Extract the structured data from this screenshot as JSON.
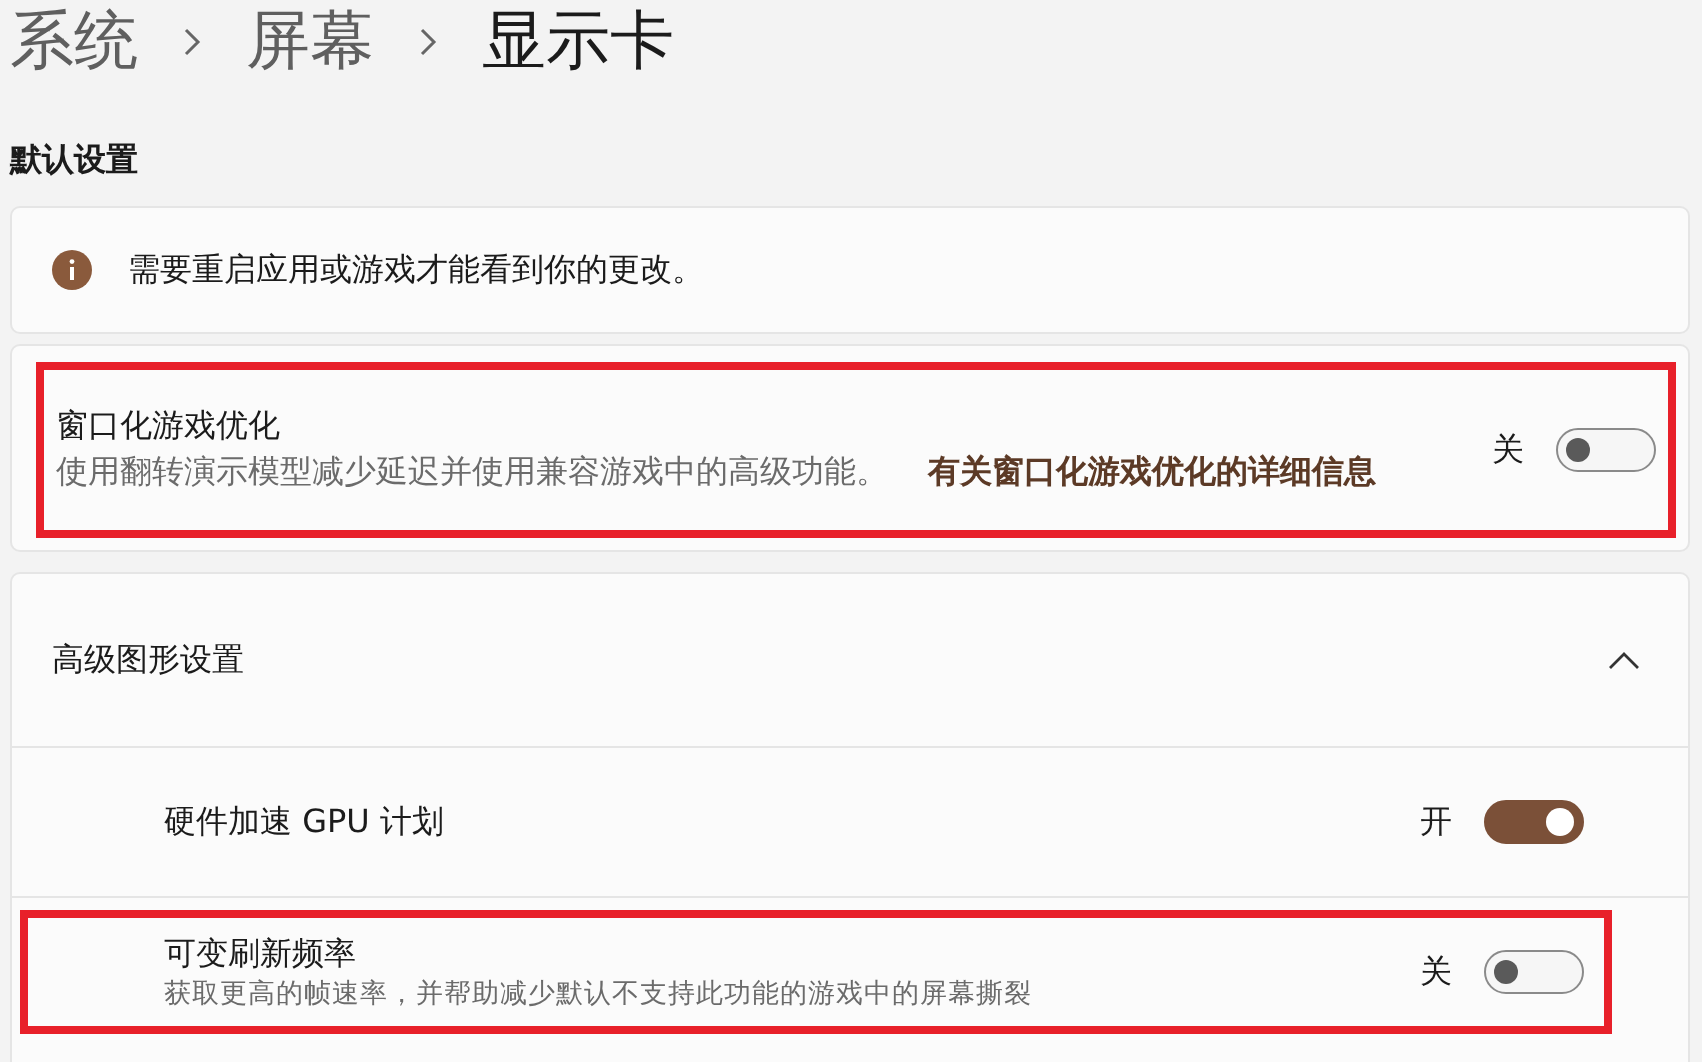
{
  "breadcrumb": [
    {
      "label": "系统",
      "current": false
    },
    {
      "label": "屏幕",
      "current": false
    },
    {
      "label": "显示卡",
      "current": true
    }
  ],
  "section_title": "默认设置",
  "notice": {
    "text": "需要重启应用或游戏才能看到你的更改。"
  },
  "game_optimization": {
    "title": "窗口化游戏优化",
    "description": "使用翻转演示模型减少延迟并使用兼容游戏中的高级功能。",
    "link": "有关窗口化游戏优化的详细信息",
    "state_label": "关",
    "on": false,
    "highlighted": true
  },
  "advanced": {
    "title": "高级图形设置",
    "expanded": true,
    "items": [
      {
        "title": "硬件加速 GPU 计划",
        "state_label": "开",
        "on": true,
        "highlighted": false
      },
      {
        "title": "可变刷新频率",
        "description": "获取更高的帧速率，并帮助减少默认不支持此功能的游戏中的屏幕撕裂",
        "state_label": "关",
        "on": false,
        "highlighted": true
      }
    ]
  }
}
